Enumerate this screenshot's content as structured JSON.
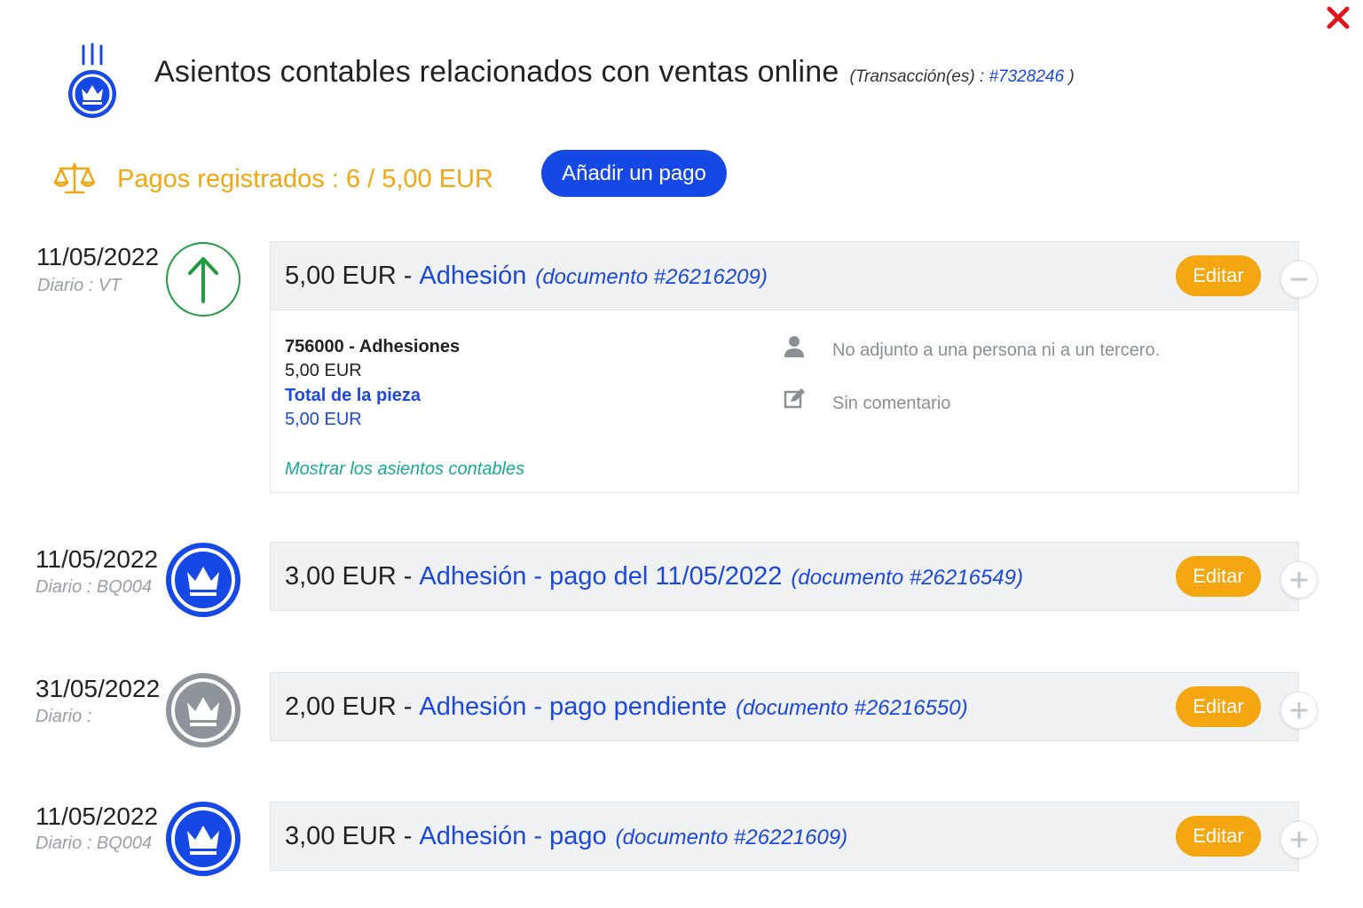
{
  "header": {
    "title": "Asientos contables relacionados con ventas online",
    "transaction_prefix": "(Transacción(es) :",
    "transaction_link": "#7328246",
    "transaction_suffix": ")"
  },
  "payments": {
    "summary": "Pagos registrados : 6 / 5,00 EUR",
    "add_button": "Añadir un pago"
  },
  "colors": {
    "primary_blue": "#1648e6",
    "accent_orange": "#f3a60f",
    "success_green": "#1e9e3e",
    "pending_gray": "#8e9499",
    "link_teal": "#19a89a",
    "close_red": "#e0141b"
  },
  "entries": [
    {
      "date": "11/05/2022",
      "journal": "Diario : VT",
      "icon": "arrow-up-icon",
      "amount": "5,00 EUR",
      "separator": "-",
      "label": "Adhesión",
      "document": "(documento #26216209)",
      "edit": "Editar",
      "expanded": true,
      "details": {
        "account": "756000 - Adhesiones",
        "account_amount": "5,00 EUR",
        "total_label": "Total de la pieza",
        "total_amount": "5,00 EUR",
        "show_entries": "Mostrar los asientos contables",
        "person": "No adjunto a una persona ni a un tercero.",
        "comment": "Sin comentario"
      }
    },
    {
      "date": "11/05/2022",
      "journal": "Diario : BQ004",
      "icon": "crown-icon",
      "amount": "3,00 EUR",
      "separator": "-",
      "label": "Adhesión - pago del 11/05/2022",
      "document": "(documento #26216549)",
      "edit": "Editar",
      "expanded": false
    },
    {
      "date": "31/05/2022",
      "journal": "Diario :",
      "icon": "crown-pending-icon",
      "amount": "2,00 EUR",
      "separator": "-",
      "label": "Adhesión - pago pendiente",
      "document": "(documento #26216550)",
      "edit": "Editar",
      "expanded": false
    },
    {
      "date": "11/05/2022",
      "journal": "Diario : BQ004",
      "icon": "crown-icon",
      "amount": "3,00 EUR",
      "separator": "-",
      "label": "Adhesión - pago",
      "document": "(documento #26221609)",
      "edit": "Editar",
      "expanded": false
    }
  ]
}
